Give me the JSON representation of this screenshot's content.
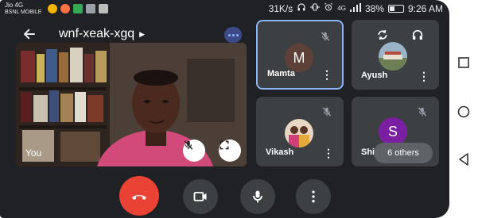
{
  "status_bar": {
    "carrier_line1": "Jio 4G",
    "carrier_line2": "BSNL MOBILE",
    "speed": "31K/s",
    "network_label": "4G",
    "battery_percent": "38%",
    "battery_level": 0.38,
    "time": "9:26 AM"
  },
  "header": {
    "meeting_code": "wnf-xeak-xgq",
    "back_icon": "arrow-back-icon",
    "caret_icon": "triangle-right-icon",
    "audio_indicator_icon": "audio-level-icon"
  },
  "self_view": {
    "name": "You",
    "mute_icon": "mic-off-icon",
    "fullscreen_icon": "fullscreen-icon"
  },
  "participants": [
    {
      "name": "Mamta",
      "avatar_letter": "M",
      "avatar_color": "#5d4037",
      "muted": true,
      "active_speaker": true
    },
    {
      "name": "Ayush",
      "avatar_letter": "",
      "avatar_type": "photo",
      "muted": false,
      "top_icons": [
        "switch-camera-icon",
        "headphones-icon"
      ]
    },
    {
      "name": "Vikash",
      "avatar_letter": "",
      "avatar_type": "photo",
      "muted": true
    },
    {
      "name": "Shiv",
      "avatar_letter": "S",
      "avatar_color": "#7b1fa2",
      "muted": true
    }
  ],
  "others_chip": {
    "label": "6 others"
  },
  "controls": {
    "end_call_icon": "call-end-icon",
    "camera_icon": "videocam-icon",
    "mic_icon": "mic-icon",
    "more_icon": "more-vert-icon"
  },
  "system_nav": {
    "recents_icon": "recents-square-icon",
    "home_icon": "home-circle-icon",
    "back_icon": "back-triangle-icon"
  },
  "colors": {
    "background": "#202124",
    "tile": "#3c4043",
    "accent": "#8ab4f8",
    "end_call": "#ea4335"
  },
  "more_glyph": "⋮"
}
